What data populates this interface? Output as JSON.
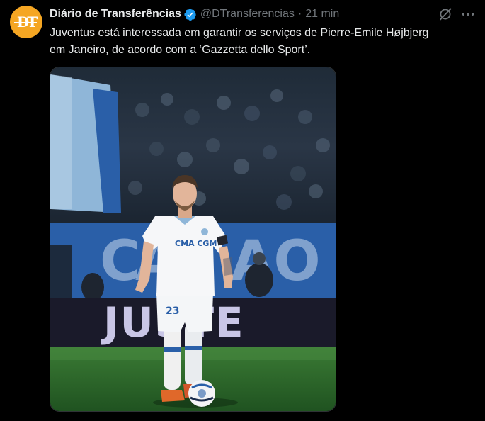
{
  "tweet": {
    "avatar_initials": "DT",
    "display_name": "Diário de Transferências",
    "handle": "@DTransferencias",
    "separator": "·",
    "time": "21 min",
    "text_line_1": "Juventus está interessada em garantir os serviços de Pierre-Emile Højbjerg",
    "text_line_2": "em Janeiro, de acordo com a ‘Gazzetta dello Sport’."
  },
  "media": {
    "banner_text": "JUSTE",
    "shirt_sponsor": "CMA CGM",
    "shirt_number": "23"
  },
  "colors": {
    "background": "#000000",
    "text_primary": "#e7e9ea",
    "text_secondary": "#71767b",
    "verified_badge": "#1d9bf0",
    "avatar_bg": "#f5a623",
    "pitch_green": "#2e6b2c",
    "stand_blue": "#2a5fa8"
  },
  "icons": {
    "verified": "verified-badge-icon",
    "grok": "grok-icon",
    "more": "more-icon"
  }
}
